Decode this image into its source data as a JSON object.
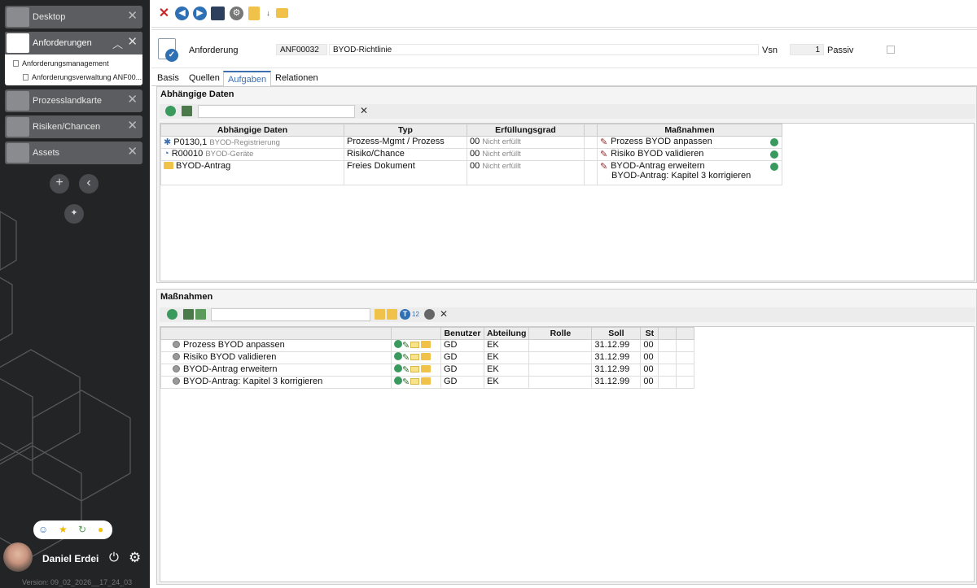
{
  "sidebar": {
    "modules": [
      {
        "label": "Desktop"
      },
      {
        "label": "Anforderungen"
      },
      {
        "label": "Prozesslandkarte"
      },
      {
        "label": "Risiken/Chancen"
      },
      {
        "label": "Assets"
      }
    ],
    "tree": {
      "parent": "Anforderungsmanagement",
      "child": "Anforderungsverwaltung ANF00..."
    },
    "user_name": "Daniel Erdei",
    "version": "Version: 09_02_2026__17_24_03"
  },
  "header": {
    "type_label": "Anforderung",
    "id": "ANF00032",
    "title": "BYOD-Richtlinie",
    "vsn_label": "Vsn",
    "vsn_value": "1",
    "passiv_label": "Passiv"
  },
  "tabs": [
    "Basis",
    "Quellen",
    "Aufgaben",
    "Relationen"
  ],
  "dependent": {
    "title": "Abhängige Daten",
    "columns": [
      "Abhängige Daten",
      "Typ",
      "Erfüllungsgrad",
      "",
      "Maßnahmen"
    ],
    "rows": [
      {
        "id": "P0130,1",
        "name": "BYOD-Registrierung",
        "typ": "Prozess-Mgmt / Prozess",
        "grad": "00",
        "status": "Nicht erfüllt",
        "measures": [
          "Prozess BYOD anpassen"
        ]
      },
      {
        "id": "R00010",
        "name": "BYOD-Geräte",
        "typ": "Risiko/Chance",
        "grad": "00",
        "status": "Nicht erfüllt",
        "measures": [
          "Risiko BYOD validieren"
        ]
      },
      {
        "id": "BYOD-Antrag",
        "name": "",
        "typ": "Freies Dokument",
        "grad": "00",
        "status": "Nicht erfüllt",
        "measures": [
          "BYOD-Antrag erweitern",
          "BYOD-Antrag: Kapitel 3 korrigieren"
        ]
      }
    ]
  },
  "measures": {
    "title": "Maßnahmen",
    "columns": [
      "",
      "",
      "Benutzer",
      "Abteilung",
      "Rolle",
      "Soll",
      "St",
      "",
      ""
    ],
    "rows": [
      {
        "name": "Prozess BYOD anpassen",
        "benutzer": "GD",
        "abteilung": "EK",
        "rolle": "",
        "soll": "31.12.99",
        "st": "00"
      },
      {
        "name": "Risiko BYOD validieren",
        "benutzer": "GD",
        "abteilung": "EK",
        "rolle": "",
        "soll": "31.12.99",
        "st": "00"
      },
      {
        "name": "BYOD-Antrag erweitern",
        "benutzer": "GD",
        "abteilung": "EK",
        "rolle": "",
        "soll": "31.12.99",
        "st": "00"
      },
      {
        "name": "BYOD-Antrag: Kapitel 3 korrigieren",
        "benutzer": "GD",
        "abteilung": "EK",
        "rolle": "",
        "soll": "31.12.99",
        "st": "00"
      }
    ]
  }
}
